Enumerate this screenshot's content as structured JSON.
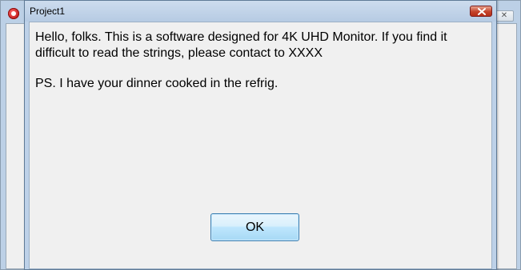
{
  "parent_window": {
    "close_glyph": "✕",
    "app_icon": "app-icon"
  },
  "dialog": {
    "title": "Project1",
    "close_icon": "close-icon",
    "message_line1": "Hello, folks. This is a software designed for 4K UHD Monitor. If you find it difficult to read the strings, please contact to XXXX",
    "message_line2": "PS. I have your dinner cooked in the refrig.",
    "ok_label": "OK"
  },
  "colors": {
    "titlebar": "#b6cbe3",
    "client_bg": "#f0f0f0",
    "close_button": "#c4432b",
    "ok_button_border": "#3c7fb1"
  }
}
